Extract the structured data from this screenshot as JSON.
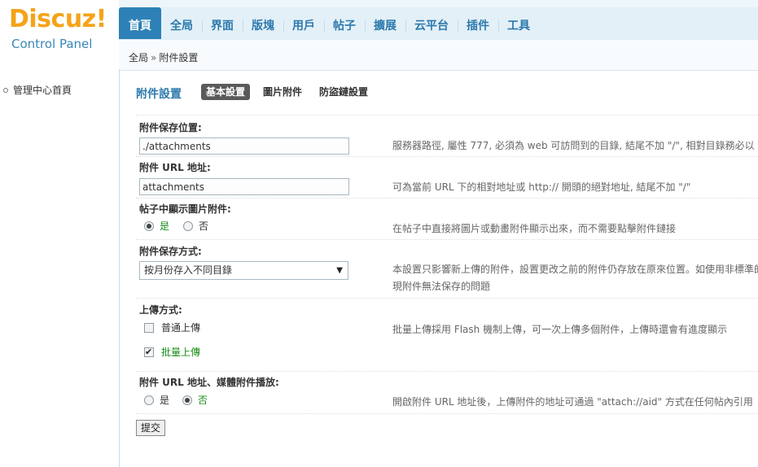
{
  "logo": {
    "word": "Discuz",
    "bang": "!",
    "sub": "Control Panel"
  },
  "topnav": [
    {
      "label": "首頁",
      "active": true
    },
    {
      "label": "全局"
    },
    {
      "label": "界面"
    },
    {
      "label": "版塊"
    },
    {
      "label": "用戶"
    },
    {
      "label": "帖子"
    },
    {
      "label": "擴展"
    },
    {
      "label": "云平台"
    },
    {
      "label": "插件"
    },
    {
      "label": "工具"
    }
  ],
  "breadcrumb": {
    "root": "全局",
    "sep": "»",
    "current": "附件設置"
  },
  "sidebar": {
    "home": "管理中心首頁"
  },
  "page": {
    "title": "附件設置",
    "tabs": [
      {
        "label": "基本設置",
        "current": true
      },
      {
        "label": "圖片附件"
      },
      {
        "label": "防盜鏈設置"
      }
    ]
  },
  "form": {
    "save_path": {
      "label": "附件保存位置:",
      "value": "./attachments",
      "tip": "服務器路徑, 屬性 777, 必須為 web 可訪問到的目錄, 結尾不加 \"/\", 相對目錄務必以"
    },
    "url": {
      "label": "附件 URL 地址:",
      "value": "attachments",
      "tip": "可為當前 URL 下的相對地址或 http:// 開頭的絕對地址, 結尾不加 \"/\""
    },
    "show_image": {
      "label": "帖子中顯示圖片附件:",
      "yes": "是",
      "no": "否",
      "selected": "yes",
      "tip": "在帖子中直接將圖片或動畫附件顯示出來，而不需要點擊附件鏈接"
    },
    "save_mode": {
      "label": "附件保存方式:",
      "selected": "按月份存入不同目錄",
      "tip_line1": "本設置只影響新上傳的附件，設置更改之前的附件仍存放在原來位置。如使用非標準的",
      "tip_line2": "現附件無法保存的問題"
    },
    "upload_mode": {
      "label": "上傳方式:",
      "normal": "普通上傳",
      "normal_checked": false,
      "batch": "批量上傳",
      "batch_checked": true,
      "tip": "批量上傳採用 Flash 機制上傳，可一次上傳多個附件，上傳時還會有進度顯示"
    },
    "media_url": {
      "label": "附件 URL 地址、媒體附件播放:",
      "yes": "是",
      "no": "否",
      "selected": "no",
      "tip": "開啟附件 URL 地址後，上傳附件的地址可通過 \"attach://aid\" 方式在任何帖內引用"
    },
    "submit_label": "提交"
  }
}
